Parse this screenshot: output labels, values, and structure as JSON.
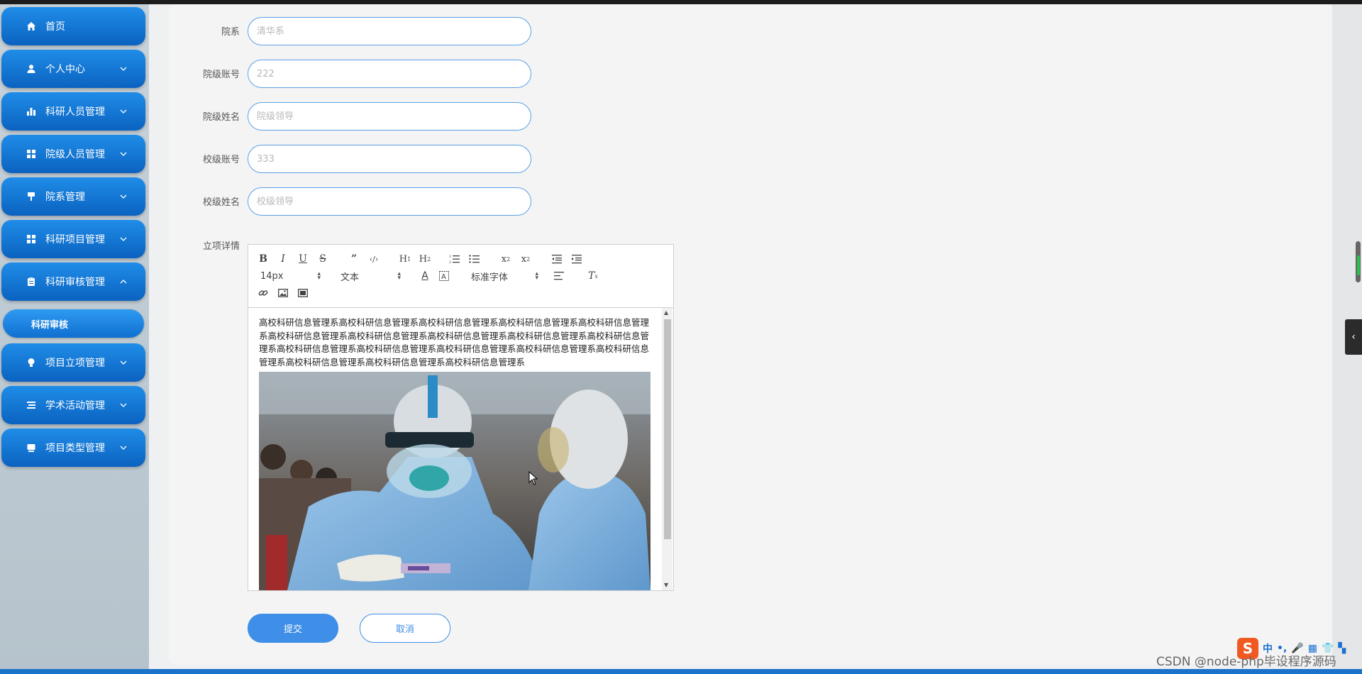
{
  "sidebar": {
    "items": [
      {
        "label": "首页",
        "icon": "home-icon",
        "has_arrow": false
      },
      {
        "label": "个人中心",
        "icon": "user-icon",
        "has_arrow": true
      },
      {
        "label": "科研人员管理",
        "icon": "bar-chart-icon",
        "has_arrow": true
      },
      {
        "label": "院级人员管理",
        "icon": "grid-icon",
        "has_arrow": true
      },
      {
        "label": "院系管理",
        "icon": "flag-icon",
        "has_arrow": true
      },
      {
        "label": "科研项目管理",
        "icon": "grid-icon",
        "has_arrow": true
      },
      {
        "label": "科研审核管理",
        "icon": "clipboard-icon",
        "has_arrow": true,
        "expanded": true
      },
      {
        "label": "项目立项管理",
        "icon": "bulb-icon",
        "has_arrow": true
      },
      {
        "label": "学术活动管理",
        "icon": "list-icon",
        "has_arrow": true
      },
      {
        "label": "项目类型管理",
        "icon": "card-icon",
        "has_arrow": true
      }
    ],
    "active_subitem": "科研审核"
  },
  "form": {
    "fields": [
      {
        "label": "院系",
        "value": "清华系"
      },
      {
        "label": "院级账号",
        "value": "222"
      },
      {
        "label": "院级姓名",
        "value": "院级领导"
      },
      {
        "label": "校级账号",
        "value": "333"
      },
      {
        "label": "校级姓名",
        "value": "校级领导"
      }
    ],
    "detail_label": "立项详情",
    "editor": {
      "font_size": "14px",
      "block_type": "文本",
      "font_family": "标准字体",
      "content_text": "高校科研信息管理系高校科研信息管理系高校科研信息管理系高校科研信息管理系高校科研信息管理系高校科研信息管理系高校科研信息管理系高校科研信息管理系高校科研信息管理系高校科研信息管理系高校科研信息管理系高校科研信息管理系高校科研信息管理系高校科研信息管理系高校科研信息管理系高校科研信息管理系高校科研信息管理系高校科研信息管理系"
    },
    "submit_label": "提交",
    "cancel_label": "取消"
  },
  "watermark": "CSDN @node-php毕设程序源码",
  "ime": {
    "logo": "S",
    "mode": "中"
  }
}
